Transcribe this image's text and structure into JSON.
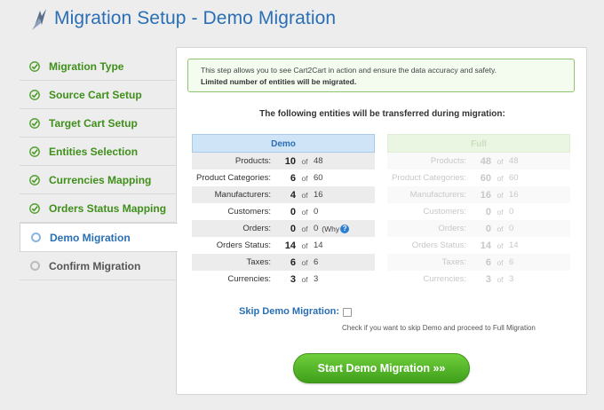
{
  "header": {
    "title": "Migration Setup - Demo Migration",
    "logo_icon": "cart2cart-logo"
  },
  "sidebar": {
    "steps": [
      {
        "label": "Migration Type",
        "state": "done",
        "icon": "check-icon"
      },
      {
        "label": "Source Cart Setup",
        "state": "done",
        "icon": "check-icon"
      },
      {
        "label": "Target Cart Setup",
        "state": "done",
        "icon": "check-icon"
      },
      {
        "label": "Entities Selection",
        "state": "done",
        "icon": "check-icon"
      },
      {
        "label": "Currencies Mapping",
        "state": "done",
        "icon": "check-icon"
      },
      {
        "label": "Orders Status Mapping",
        "state": "done",
        "icon": "check-icon"
      },
      {
        "label": "Demo Migration",
        "state": "active",
        "icon": "ring-icon"
      },
      {
        "label": "Confirm Migration",
        "state": "pending",
        "icon": "ring-icon"
      }
    ]
  },
  "notice": {
    "line1": "This step allows you to see Cart2Cart in action and ensure the data accuracy and safety.",
    "line2": "Limited number of entities will be migrated."
  },
  "entities_title": "The following entities will be transferred during migration:",
  "demo_table": {
    "header": "Demo",
    "of_label": "of",
    "rows": [
      {
        "label": "Products:",
        "value": "10",
        "total": "48"
      },
      {
        "label": "Product Categories:",
        "value": "6",
        "total": "60"
      },
      {
        "label": "Manufacturers:",
        "value": "4",
        "total": "16"
      },
      {
        "label": "Customers:",
        "value": "0",
        "total": "0"
      },
      {
        "label": "Orders:",
        "value": "0",
        "total": "0",
        "note": "(Why",
        "help": "?"
      },
      {
        "label": "Orders Status:",
        "value": "14",
        "total": "14"
      },
      {
        "label": "Taxes:",
        "value": "6",
        "total": "6"
      },
      {
        "label": "Currencies:",
        "value": "3",
        "total": "3"
      }
    ]
  },
  "full_table": {
    "header": "Full",
    "of_label": "of",
    "rows": [
      {
        "label": "Products:",
        "value": "48",
        "total": "48"
      },
      {
        "label": "Product Categories:",
        "value": "60",
        "total": "60"
      },
      {
        "label": "Manufacturers:",
        "value": "16",
        "total": "16"
      },
      {
        "label": "Customers:",
        "value": "0",
        "total": "0"
      },
      {
        "label": "Orders:",
        "value": "0",
        "total": "0"
      },
      {
        "label": "Orders Status:",
        "value": "14",
        "total": "14"
      },
      {
        "label": "Taxes:",
        "value": "6",
        "total": "6"
      },
      {
        "label": "Currencies:",
        "value": "3",
        "total": "3"
      }
    ]
  },
  "skip": {
    "label": "Skip Demo Migration:",
    "hint": "Check if you want to skip Demo and proceed to Full Migration",
    "checked": false
  },
  "start_button": {
    "label": "Start Demo Migration »»"
  },
  "colors": {
    "accent_blue": "#2a6fb5",
    "success_green": "#3f8f1a",
    "button_green": "#4fb225"
  }
}
